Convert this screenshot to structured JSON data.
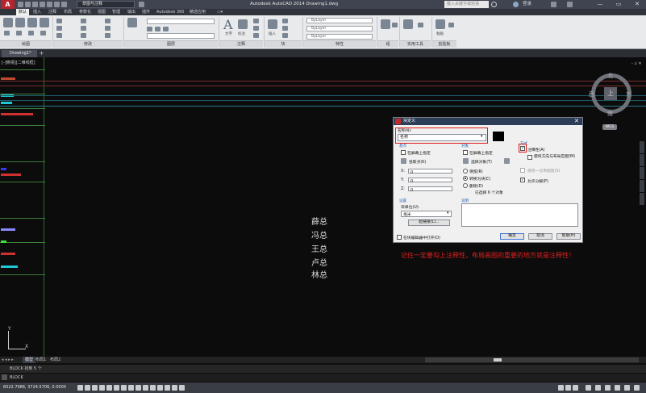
{
  "titlebar": {
    "workspace": "草图与注释",
    "doc_title": "Autodesk AutoCAD 2014    Drawing1.dwg",
    "search_placeholder": "键入关键字或短语",
    "login": "登录",
    "minimize": "—",
    "restore": "▭",
    "close": "✕"
  },
  "menu_tabs": [
    "默认",
    "插入",
    "注释",
    "布局",
    "参数化",
    "视图",
    "管理",
    "输出",
    "插件",
    "Autodesk 360",
    "精选应用"
  ],
  "ribbon": {
    "panels": [
      "绘图",
      "修改",
      "图层",
      "注释",
      "块",
      "特性",
      "组",
      "实用工具",
      "剪贴板"
    ],
    "bylayer_1": "ByLayer",
    "bylayer_2": "ByLayer",
    "bylayer_3": "ByLayer",
    "text_label": "文字",
    "annot_label": "标注",
    "insert_label": "插入",
    "match_label": "特性匹配",
    "paste_label": "粘贴"
  },
  "document_tab": "Drawing1*",
  "canvas": {
    "view_label": "[-]俯视][二维线框]",
    "names": [
      "薛总",
      "冯总",
      "王总",
      "卢总",
      "林总"
    ],
    "annotation": "记住一定要勾上注释性，布局画图的重要的地方就是注释性！",
    "compass": {
      "north": "北",
      "south": "南",
      "east": "东",
      "west": "西",
      "top": "上"
    },
    "wcs": "WCS",
    "ucs_x": "X",
    "ucs_y": "Y"
  },
  "dialog": {
    "title": "块定义",
    "close": "✕",
    "name_label": "名称(N):",
    "name_value": "名称",
    "base_point": {
      "title": "基点",
      "on_screen": "在屏幕上指定",
      "pick": "拾取点(K)",
      "x_label": "X:",
      "y_label": "Y:",
      "z_label": "Z:",
      "x": "0",
      "y": "0",
      "z": "0"
    },
    "objects": {
      "title": "对象",
      "on_screen": "在屏幕上指定",
      "select": "选择对象(T)",
      "retain": "保留(R)",
      "convert": "转换为块(C)",
      "delete": "删除(D)",
      "selected": "已选择 6 个对象"
    },
    "behavior": {
      "title": "方式",
      "annotative": "注释性(A)",
      "match_orient": "使块方向与布局匹配(M)",
      "uniform": "按统一比例缩放(S)",
      "explode": "允许分解(P)"
    },
    "settings": {
      "title": "设置",
      "unit_label": "块单位(U):",
      "unit_value": "毫米",
      "hyperlink": "超链接(L)..."
    },
    "description_label": "说明",
    "open_editor": "在块编辑器中打开(O)",
    "ok": "确定",
    "cancel": "取消",
    "help": "帮助(H)"
  },
  "layout_tabs": [
    "模型",
    "布局1",
    "布局2"
  ],
  "command": {
    "history": "BLOCK 找到 5 个",
    "prompt": "BLOCK"
  },
  "status": {
    "coords": "6022.7986, 3724.5706, 0.0000"
  },
  "colors": {
    "dialog_highlight": "#e21a1a",
    "annotation_text": "#e1201f",
    "canvas_bg": "#0c0c0c"
  }
}
